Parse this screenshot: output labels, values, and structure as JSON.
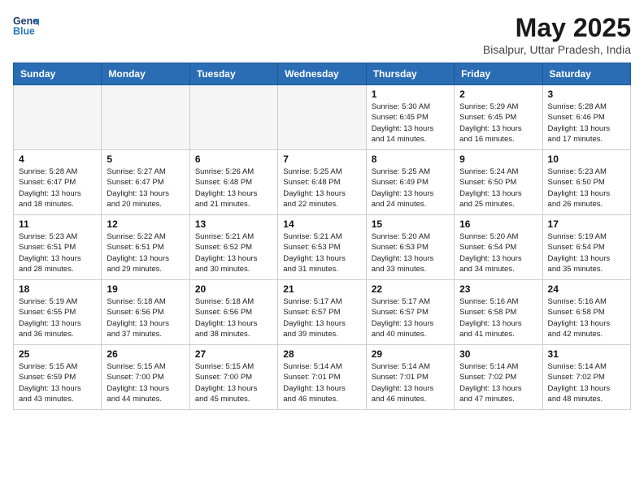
{
  "header": {
    "logo_line1": "General",
    "logo_line2": "Blue",
    "month": "May 2025",
    "location": "Bisalpur, Uttar Pradesh, India"
  },
  "weekdays": [
    "Sunday",
    "Monday",
    "Tuesday",
    "Wednesday",
    "Thursday",
    "Friday",
    "Saturday"
  ],
  "weeks": [
    [
      {
        "day": "",
        "info": ""
      },
      {
        "day": "",
        "info": ""
      },
      {
        "day": "",
        "info": ""
      },
      {
        "day": "",
        "info": ""
      },
      {
        "day": "1",
        "info": "Sunrise: 5:30 AM\nSunset: 6:45 PM\nDaylight: 13 hours\nand 14 minutes."
      },
      {
        "day": "2",
        "info": "Sunrise: 5:29 AM\nSunset: 6:45 PM\nDaylight: 13 hours\nand 16 minutes."
      },
      {
        "day": "3",
        "info": "Sunrise: 5:28 AM\nSunset: 6:46 PM\nDaylight: 13 hours\nand 17 minutes."
      }
    ],
    [
      {
        "day": "4",
        "info": "Sunrise: 5:28 AM\nSunset: 6:47 PM\nDaylight: 13 hours\nand 18 minutes."
      },
      {
        "day": "5",
        "info": "Sunrise: 5:27 AM\nSunset: 6:47 PM\nDaylight: 13 hours\nand 20 minutes."
      },
      {
        "day": "6",
        "info": "Sunrise: 5:26 AM\nSunset: 6:48 PM\nDaylight: 13 hours\nand 21 minutes."
      },
      {
        "day": "7",
        "info": "Sunrise: 5:25 AM\nSunset: 6:48 PM\nDaylight: 13 hours\nand 22 minutes."
      },
      {
        "day": "8",
        "info": "Sunrise: 5:25 AM\nSunset: 6:49 PM\nDaylight: 13 hours\nand 24 minutes."
      },
      {
        "day": "9",
        "info": "Sunrise: 5:24 AM\nSunset: 6:50 PM\nDaylight: 13 hours\nand 25 minutes."
      },
      {
        "day": "10",
        "info": "Sunrise: 5:23 AM\nSunset: 6:50 PM\nDaylight: 13 hours\nand 26 minutes."
      }
    ],
    [
      {
        "day": "11",
        "info": "Sunrise: 5:23 AM\nSunset: 6:51 PM\nDaylight: 13 hours\nand 28 minutes."
      },
      {
        "day": "12",
        "info": "Sunrise: 5:22 AM\nSunset: 6:51 PM\nDaylight: 13 hours\nand 29 minutes."
      },
      {
        "day": "13",
        "info": "Sunrise: 5:21 AM\nSunset: 6:52 PM\nDaylight: 13 hours\nand 30 minutes."
      },
      {
        "day": "14",
        "info": "Sunrise: 5:21 AM\nSunset: 6:53 PM\nDaylight: 13 hours\nand 31 minutes."
      },
      {
        "day": "15",
        "info": "Sunrise: 5:20 AM\nSunset: 6:53 PM\nDaylight: 13 hours\nand 33 minutes."
      },
      {
        "day": "16",
        "info": "Sunrise: 5:20 AM\nSunset: 6:54 PM\nDaylight: 13 hours\nand 34 minutes."
      },
      {
        "day": "17",
        "info": "Sunrise: 5:19 AM\nSunset: 6:54 PM\nDaylight: 13 hours\nand 35 minutes."
      }
    ],
    [
      {
        "day": "18",
        "info": "Sunrise: 5:19 AM\nSunset: 6:55 PM\nDaylight: 13 hours\nand 36 minutes."
      },
      {
        "day": "19",
        "info": "Sunrise: 5:18 AM\nSunset: 6:56 PM\nDaylight: 13 hours\nand 37 minutes."
      },
      {
        "day": "20",
        "info": "Sunrise: 5:18 AM\nSunset: 6:56 PM\nDaylight: 13 hours\nand 38 minutes."
      },
      {
        "day": "21",
        "info": "Sunrise: 5:17 AM\nSunset: 6:57 PM\nDaylight: 13 hours\nand 39 minutes."
      },
      {
        "day": "22",
        "info": "Sunrise: 5:17 AM\nSunset: 6:57 PM\nDaylight: 13 hours\nand 40 minutes."
      },
      {
        "day": "23",
        "info": "Sunrise: 5:16 AM\nSunset: 6:58 PM\nDaylight: 13 hours\nand 41 minutes."
      },
      {
        "day": "24",
        "info": "Sunrise: 5:16 AM\nSunset: 6:58 PM\nDaylight: 13 hours\nand 42 minutes."
      }
    ],
    [
      {
        "day": "25",
        "info": "Sunrise: 5:15 AM\nSunset: 6:59 PM\nDaylight: 13 hours\nand 43 minutes."
      },
      {
        "day": "26",
        "info": "Sunrise: 5:15 AM\nSunset: 7:00 PM\nDaylight: 13 hours\nand 44 minutes."
      },
      {
        "day": "27",
        "info": "Sunrise: 5:15 AM\nSunset: 7:00 PM\nDaylight: 13 hours\nand 45 minutes."
      },
      {
        "day": "28",
        "info": "Sunrise: 5:14 AM\nSunset: 7:01 PM\nDaylight: 13 hours\nand 46 minutes."
      },
      {
        "day": "29",
        "info": "Sunrise: 5:14 AM\nSunset: 7:01 PM\nDaylight: 13 hours\nand 46 minutes."
      },
      {
        "day": "30",
        "info": "Sunrise: 5:14 AM\nSunset: 7:02 PM\nDaylight: 13 hours\nand 47 minutes."
      },
      {
        "day": "31",
        "info": "Sunrise: 5:14 AM\nSunset: 7:02 PM\nDaylight: 13 hours\nand 48 minutes."
      }
    ]
  ]
}
